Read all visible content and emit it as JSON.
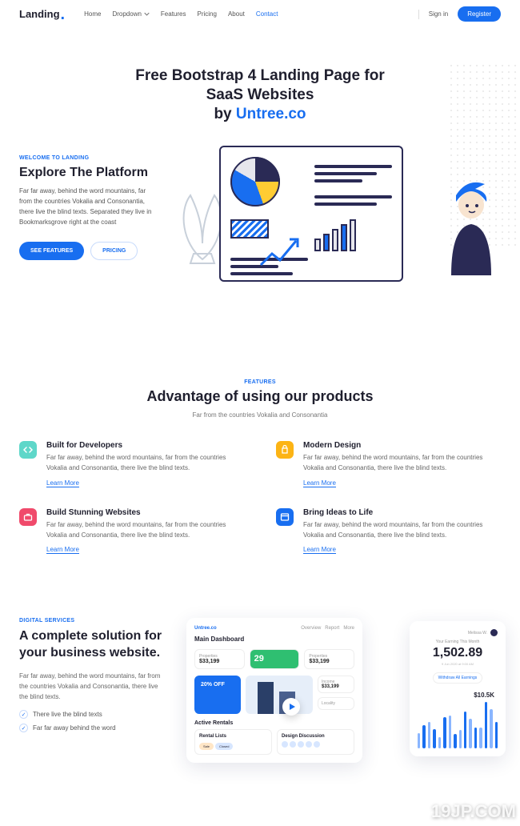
{
  "nav": {
    "logo": "Landing",
    "links": [
      "Home",
      "Dropdown",
      "Features",
      "Pricing",
      "About",
      "Contact"
    ],
    "active_index": 5,
    "signin": "Sign in",
    "register": "Register"
  },
  "hero": {
    "line1": "Free Bootstrap 4 Landing Page for",
    "line2": "SaaS Websites",
    "by": "by ",
    "brand": "Untree.co"
  },
  "explore": {
    "eyebrow": "WELCOME TO LANDING",
    "title": "Explore The Platform",
    "body": "Far far away, behind the word mountains, far from the countries Vokalia and Consonantia, there live the blind texts. Separated they live in Bookmarksgrove right at the coast",
    "cta_primary": "SEE FEATURES",
    "cta_secondary": "PRICING"
  },
  "features": {
    "eyebrow": "FEATURES",
    "title": "Advantage of using our products",
    "subtitle": "Far from the countries Vokalia and Consonantia",
    "items": [
      {
        "title": "Built for Developers",
        "body": "Far far away, behind the word mountains, far from the countries Vokalia and Consonantia, there live the blind texts.",
        "link": "Learn More",
        "icon": "code-icon",
        "color": "teal"
      },
      {
        "title": "Modern Design",
        "body": "Far far away, behind the word mountains, far from the countries Vokalia and Consonantia, there live the blind texts.",
        "link": "Learn More",
        "icon": "bag-icon",
        "color": "amber"
      },
      {
        "title": "Build Stunning Websites",
        "body": "Far far away, behind the word mountains, far from the countries Vokalia and Consonantia, there live the blind texts.",
        "link": "Learn More",
        "icon": "briefcase-icon",
        "color": "red"
      },
      {
        "title": "Bring Ideas to Life",
        "body": "Far far away, behind the word mountains, far from the countries Vokalia and Consonantia, there live the blind texts.",
        "link": "Learn More",
        "icon": "window-icon",
        "color": "blue"
      }
    ]
  },
  "solution": {
    "eyebrow": "DIGITAL SERVICES",
    "title": "A complete solution for your business website.",
    "body": "Far far away, behind the word mountains, far from the countries Vokalia and Consonantia, there live the blind texts.",
    "checks": [
      "There live the blind texts",
      "Far far away behind the word"
    ]
  },
  "dashboard": {
    "brand": "Untree.co",
    "tabs": [
      "Overview",
      "Report",
      "More"
    ],
    "title": "Main Dashboard",
    "stats": [
      {
        "label": "Properties",
        "value": "$33,199"
      },
      {
        "label": "",
        "value": "29"
      },
      {
        "label": "Properties",
        "value": "$33,199"
      }
    ],
    "promo": "20% OFF",
    "minis": [
      {
        "label": "Income",
        "value": "$33,199"
      },
      {
        "label": "Locality",
        "value": ""
      }
    ],
    "active_rentals": "Active Rentals",
    "rental_card": "Rental Lists",
    "rental_pills": [
      "Sale",
      "Closed"
    ],
    "design_card": "Design Discussion",
    "right": {
      "user": "Melissa W.",
      "label": "Your Earning This Month",
      "value": "1,502.89",
      "sub": "9 Jun 2020 at 9:00 AM",
      "toggle": "Withdraw All Earnings",
      "amount": "$10.5K"
    }
  },
  "watermark": "19JP.COM",
  "chart_data": {
    "type": "bar",
    "note": "Decorative dashboard mock bar heights (no axis labels in image)",
    "series": [
      {
        "name": "light",
        "values": [
          24,
          40,
          18,
          50,
          28,
          45,
          32,
          60
        ]
      },
      {
        "name": "dark",
        "values": [
          36,
          30,
          48,
          22,
          56,
          32,
          70,
          40
        ]
      }
    ]
  }
}
